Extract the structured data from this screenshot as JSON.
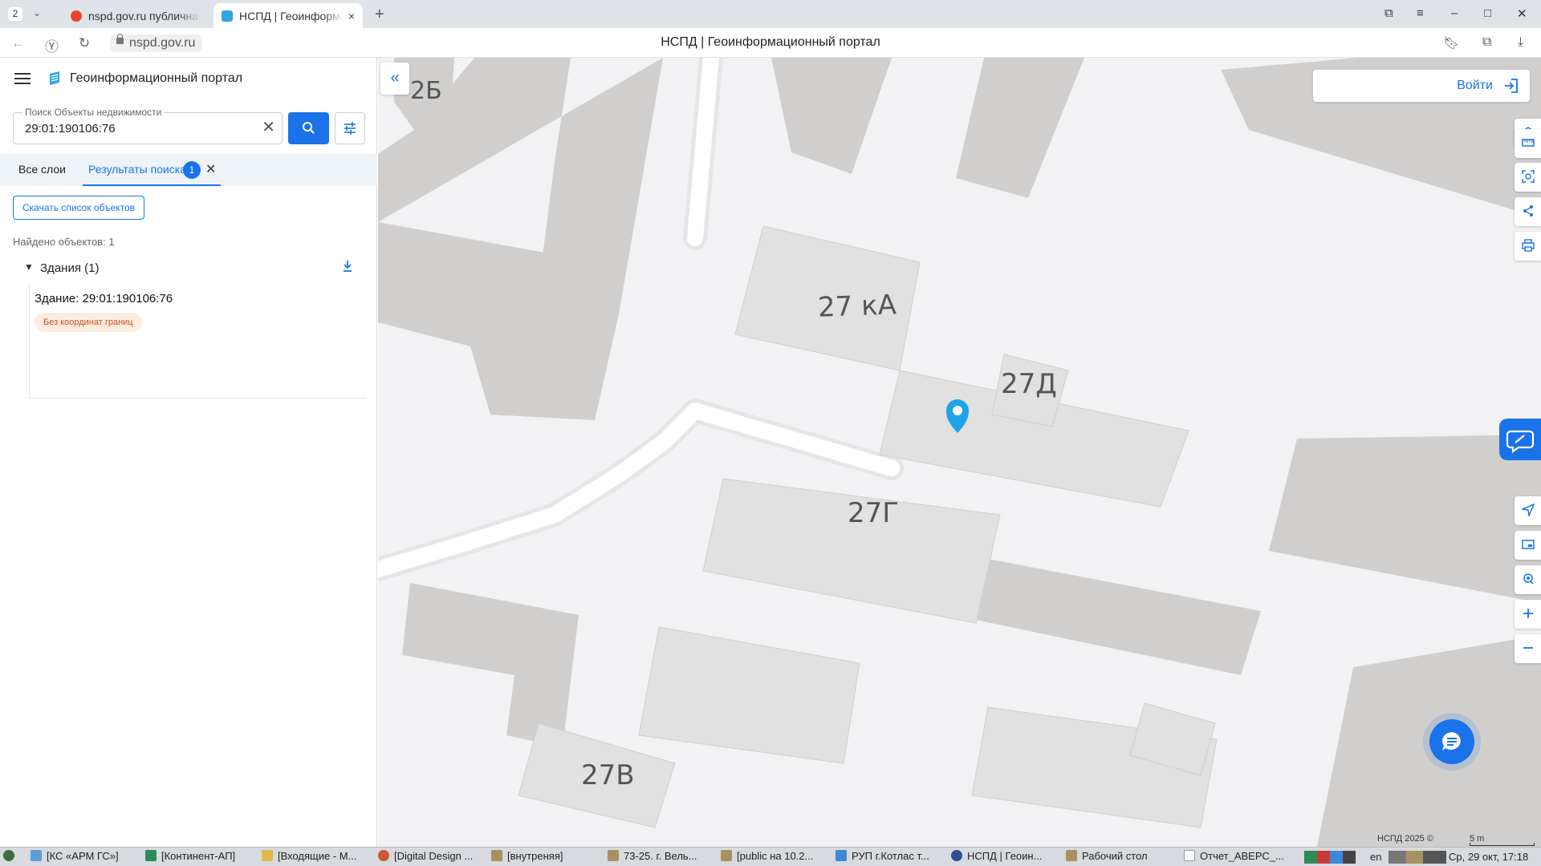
{
  "browser": {
    "tab_count": "2",
    "tabs": [
      {
        "title": "nspd.gov.ru публичная"
      },
      {
        "title": "НСПД | Геоинформа",
        "close": "×"
      }
    ],
    "url": "nspd.gov.ru",
    "page_title": "НСПД | Геоинформационный портал"
  },
  "panel": {
    "portal_title": "Геоинформационный портал",
    "search": {
      "label": "Поиск Объекты недвижимости",
      "value": "29:01:190106:76"
    },
    "tabs": [
      {
        "label": "Все слои"
      },
      {
        "label": "Результаты поиска",
        "badge": "1"
      }
    ],
    "download_list_label": "Скачать список объектов",
    "found_text": "Найдено объектов: 1",
    "group": {
      "title": "Здания (1)",
      "items": [
        {
          "title": "Здание: 29:01:190106:76",
          "badge": "Без координат границ"
        }
      ]
    }
  },
  "map": {
    "login_label": "Войти",
    "labels": [
      "2Б",
      "27 кА",
      "27Д",
      "27Г",
      "27В"
    ],
    "copyright": "НСПД 2025 ©",
    "scale": "5 m",
    "colors": {
      "accent": "#1a73e8",
      "building": "#d1cfcd",
      "building_light": "#e1e1e1",
      "marker": "#1fa3e8"
    }
  },
  "taskbar": {
    "items": [
      "[КС «АРМ ГС»]",
      "[Континент-АП]",
      "[Входящие - М...",
      "[Digital Design ...",
      "[внутреняя]",
      "73-25. г. Вель...",
      "[public на 10.2...",
      "РУП г.Котлас т...",
      "НСПД | Геоин...",
      "Рабочий стол",
      "Отчет_АВЕРС_..."
    ],
    "lang": "en",
    "clock": "Ср, 29 окт, 17:18"
  }
}
